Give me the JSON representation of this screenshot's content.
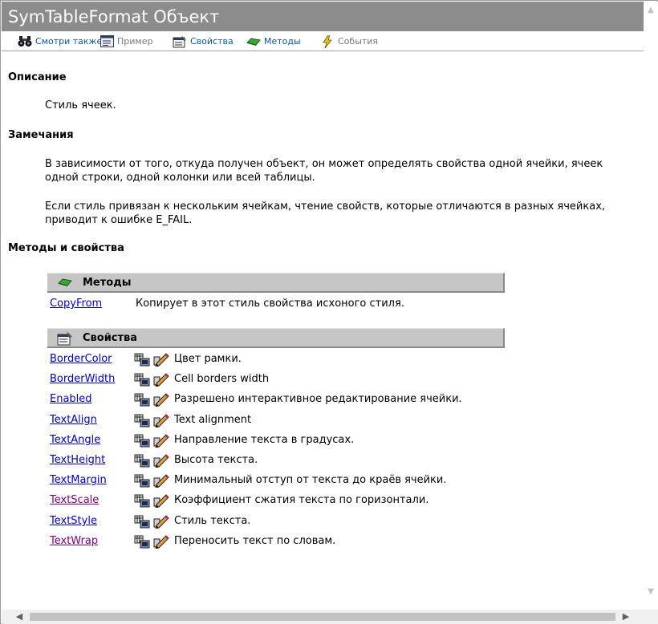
{
  "window": {
    "title": "SymTableFormat Объект"
  },
  "toolbar": {
    "see_also": "Смотри также",
    "example": "Пример",
    "properties": "Свойства",
    "methods": "Методы",
    "events": "События"
  },
  "sections": {
    "description_heading": "Описание",
    "description_text": "Стиль ячеек.",
    "remarks_heading": "Замечания",
    "remarks_p1": "В зависимости от того, откуда получен объект, он может определять свойства одной ячейки, ячеек одной строки, одной колонки или всей таблицы.",
    "remarks_p2": "Если стиль привязан к нескольким ячейкам, чтение свойств, которые отличаются в разных ячейках, приводит к ошибке E_FAIL.",
    "members_heading": "Методы и свойства"
  },
  "methods_table": {
    "header": "Методы",
    "rows": [
      {
        "name": "CopyFrom",
        "desc": "Копирует в этот стиль свойства исхоного стиля."
      }
    ]
  },
  "properties_table": {
    "header": "Свойства",
    "rows": [
      {
        "name": "BorderColor",
        "desc": "Цвет рамки.",
        "visited": false
      },
      {
        "name": "BorderWidth",
        "desc": "Cell borders width",
        "visited": false
      },
      {
        "name": "Enabled",
        "desc": "Разрешено интерактивное редактирование ячейки.",
        "visited": false
      },
      {
        "name": "TextAlign",
        "desc": "Text alignment",
        "visited": false
      },
      {
        "name": "TextAngle",
        "desc": "Направление текста в градусах.",
        "visited": false
      },
      {
        "name": "TextHeight",
        "desc": "Высота текста.",
        "visited": false
      },
      {
        "name": "TextMargin",
        "desc": "Минимальный отступ от текста до краёв ячейки.",
        "visited": false
      },
      {
        "name": "TextScale",
        "desc": "Коэффициент сжатия текста по горизонтали.",
        "visited": true
      },
      {
        "name": "TextStyle",
        "desc": "Стиль текста.",
        "visited": false
      },
      {
        "name": "TextWrap",
        "desc": "Переносить текст по словам.",
        "visited": true
      }
    ]
  },
  "icons": {
    "see_also": "binoculars-icon",
    "example": "example-icon",
    "properties": "properties-icon",
    "methods": "method-icon",
    "events": "lightning-icon",
    "property_get": "get-property-icon",
    "property_set": "set-property-icon"
  },
  "colors": {
    "title_bar": "#8c8c8c",
    "link": "#0000cc",
    "visited_link": "#800080",
    "table_header": "#c6c6c6"
  }
}
